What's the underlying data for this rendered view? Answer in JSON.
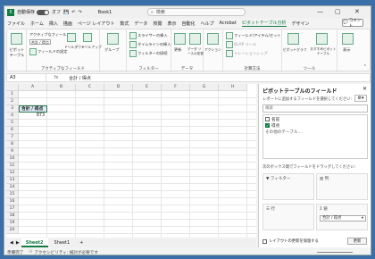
{
  "titlebar": {
    "autosave_label": "自動保存",
    "toggle_state": "オフ",
    "book_title": "Book1",
    "search_placeholder": "検索",
    "min": "—",
    "max": "▢",
    "close": "✕"
  },
  "menu": [
    "ファイル",
    "ホーム",
    "挿入",
    "描画",
    "ページ レイアウト",
    "数式",
    "データ",
    "校閲",
    "表示",
    "自動化",
    "ヘルプ",
    "Acrobat",
    "ピボットテーブル分析",
    "デザイン"
  ],
  "menu_active_index": 12,
  "comment_button": "コメント",
  "ribbon": {
    "pivot_table": "ピボットテーブル",
    "active_field_label": "アクティブなフィールド:",
    "active_field_value": "合計 / 得点",
    "field_settings": "フィールドの設定",
    "drill_down": "ドリルダウン",
    "drill_up": "ドリルアップ",
    "active_field_group": "アクティブなフィールド",
    "group": "グループ",
    "slicer": "スライサーの挿入",
    "timeline": "タイムラインの挿入",
    "filter_connections": "フィルターの接続",
    "filter_group": "フィルター",
    "refresh": "更新",
    "change_source": "データ ソースの変更",
    "data_group": "データ",
    "actions": "アクション",
    "fields_items_sets": "フィールド/アイテム/セット",
    "olap_tools": "OLAP ツール",
    "relationships": "リレーションシップ",
    "calc_group": "計算方法",
    "pivot_chart": "ピボットグラフ",
    "recommended": "おすすめピボットテーブル",
    "tools_group": "ツール",
    "show": "表示"
  },
  "formula": {
    "namebox": "A3",
    "fx": "fx",
    "content": "合計 / 得点"
  },
  "grid": {
    "columns": [
      "A",
      "B",
      "C",
      "D",
      "E",
      "F",
      "G",
      "H"
    ],
    "rows": [
      "1",
      "2",
      "3",
      "4",
      "5",
      "6",
      "7",
      "8",
      "9",
      "10",
      "11",
      "12",
      "13",
      "14",
      "15",
      "16",
      "17",
      "18",
      "19",
      "20"
    ],
    "pivot_header": "合計 / 得点",
    "pivot_value": "873"
  },
  "sheets": [
    "Sheet2",
    "Sheet1"
  ],
  "add_sheet": "+",
  "status": {
    "mode": "準備完了",
    "accessibility": "アクセシビリティ: 検討が必要です"
  },
  "pane": {
    "title": "ピボットテーブルのフィールド",
    "subtitle": "レポートに追加するフィールドを選択してください:",
    "search_placeholder": "検索",
    "fields": [
      {
        "name": "名前",
        "checked": false
      },
      {
        "name": "得点",
        "checked": true
      }
    ],
    "more_tables": "その他のテーブル...",
    "drag_hint": "次のボックス間でフィールドをドラッグしてください:",
    "area_filter": "フィルター",
    "area_columns": "列",
    "area_rows": "行",
    "area_values": "値",
    "values_item": "合計 / 得点",
    "defer_label": "レイアウトの更新を保留する",
    "update": "更新"
  }
}
